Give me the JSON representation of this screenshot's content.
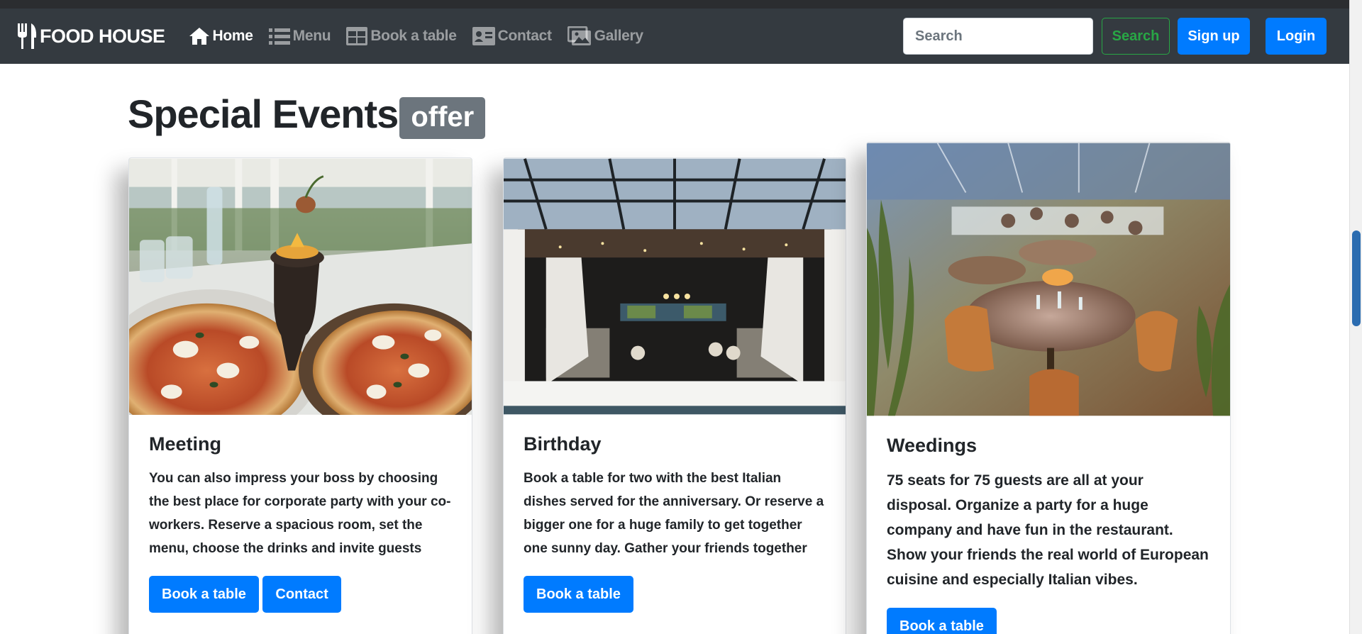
{
  "navbar": {
    "brand": "FOOD HOUSE",
    "links": [
      {
        "label": "Home",
        "icon": "home-icon",
        "active": true
      },
      {
        "label": "Menu",
        "icon": "list-icon",
        "active": false
      },
      {
        "label": "Book a table",
        "icon": "table-icon",
        "active": false
      },
      {
        "label": "Contact",
        "icon": "contact-card-icon",
        "active": false
      },
      {
        "label": "Gallery",
        "icon": "gallery-icon",
        "active": false
      }
    ],
    "search_placeholder": "Search",
    "search_button": "Search",
    "signup_button": "Sign up",
    "login_button": "Login"
  },
  "section": {
    "title": "Special Events",
    "badge": "offer"
  },
  "cards": [
    {
      "title": "Meeting",
      "text": "You can also impress your boss by choosing the best place for corporate party with your co-workers. Reserve a spacious room, set the menu, choose the drinks and invite guests",
      "buttons": [
        "Book a table",
        "Contact"
      ],
      "image": "pizza-table-photo"
    },
    {
      "title": "Birthday",
      "text": "Book a table for two with the best Italian dishes served for the anniversary. Or reserve a bigger one for a huge family to get together one sunny day. Gather your friends together",
      "buttons": [
        "Book a table"
      ],
      "image": "restaurant-window-photo"
    },
    {
      "title": "Weedings",
      "text": "75 seats for 75 guests are all at your disposal. Organize a party for a huge company and have fun in the restaurant. Show your friends the real world of European cuisine and especially Italian vibes.",
      "buttons": [
        "Book a table"
      ],
      "image": "terrace-dining-photo"
    }
  ],
  "colors": {
    "navbar_bg": "#343a40",
    "primary": "#007bff",
    "success": "#28a745",
    "badge_bg": "#6c757d"
  }
}
